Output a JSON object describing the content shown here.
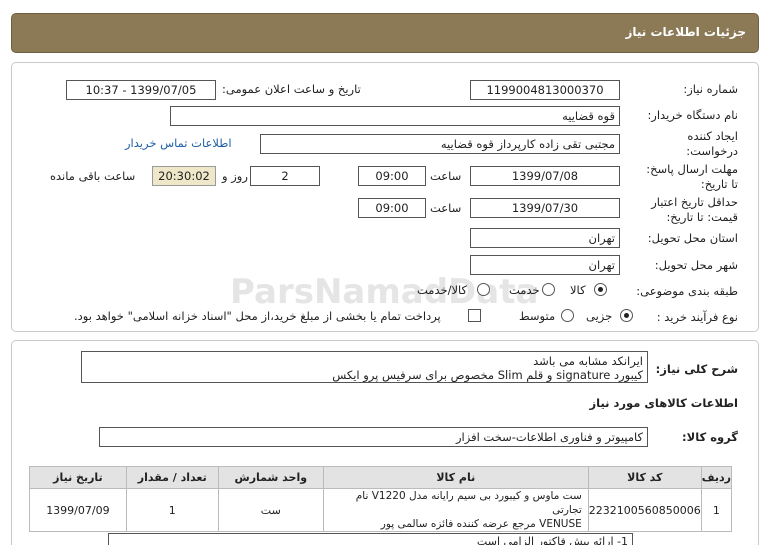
{
  "title": "جزئیات اطلاعات نیاز",
  "fields": {
    "need_number_label": "شماره نیاز:",
    "need_number": "1199004813000370",
    "announce_label": "تاریخ و ساعت اعلان عمومی:",
    "announce_value": "1399/07/05 - 10:37",
    "buyer_org_label": "نام دستگاه خریدار:",
    "buyer_org": "قوه قضاییه",
    "creator_label": "ایجاد کننده درخواست:",
    "creator": "مجتبی تقی زاده کارپرداز قوه قضاییه",
    "contact_link": "اطلاعات تماس خریدار",
    "deadline_label": "مهلت ارسال پاسخ: تا تاریخ:",
    "deadline_date": "1399/07/08",
    "time_label": "ساعت",
    "deadline_time": "09:00",
    "days_value": "2",
    "days_label": "روز و",
    "remaining_time": "20:30:02",
    "remaining_label": "ساعت باقی مانده",
    "validity_label": "حداقل تاریخ اعتبار قیمت: تا تاریخ:",
    "validity_date": "1399/07/30",
    "validity_time": "09:00",
    "province_label": "استان محل تحویل:",
    "province": "تهران",
    "city_label": "شهر محل تحویل:",
    "city": "تهران",
    "category_label": "طبقه بندی موضوعی:",
    "category_options": [
      "کالا",
      "خدمت",
      "کالا/خدمت"
    ],
    "process_label": "نوع فرآیند خرید :",
    "process_options": [
      "جزیی",
      "متوسط"
    ],
    "payment_note": "پرداخت تمام یا بخشی از مبلغ خرید،از محل \"اسناد خزانه اسلامی\" خواهد بود."
  },
  "description": {
    "label": "شرح کلی نیاز:",
    "line1": "ایرانکد مشابه می باشد",
    "line2": "کیبورد signature و قلم Slim  مخصوص برای سرفیس پرو ایکس"
  },
  "goods": {
    "section_title": "اطلاعات کالاهای مورد نیاز",
    "group_label": "گروه کالا:",
    "group_value": "کامپیوتر و فناوری اطلاعات-سخت افزار",
    "headers": [
      "ردیف",
      "کد کالا",
      "نام کالا",
      "واحد شمارش",
      "تعداد / مقدار",
      "تاریخ نیاز"
    ],
    "rows": [
      {
        "row": "1",
        "code": "2232100560850006",
        "name_line1": "ست ماوس و کیبورد بی سیم رایانه مدل V1220 نام تجارتی",
        "name_line2": "VENUSE مرجع عرضه کننده فائزه سالمی پور",
        "unit": "ست",
        "qty": "1",
        "date": "1399/07/09"
      }
    ]
  },
  "bottom_note": "1- ارائه پیش فاکتور الزامی است",
  "watermark": {
    "line1": "ParsNamadData",
    "line2": "پایگاه اطلاع رسانی مناقصه و مزایده",
    "line3": "۰۲۱-۸۸۳۴۹۶۷۰"
  },
  "colors": {
    "titlebar": "#8b7a55",
    "link": "#1f5fa8",
    "remaining_bg": "#efe8c8"
  }
}
